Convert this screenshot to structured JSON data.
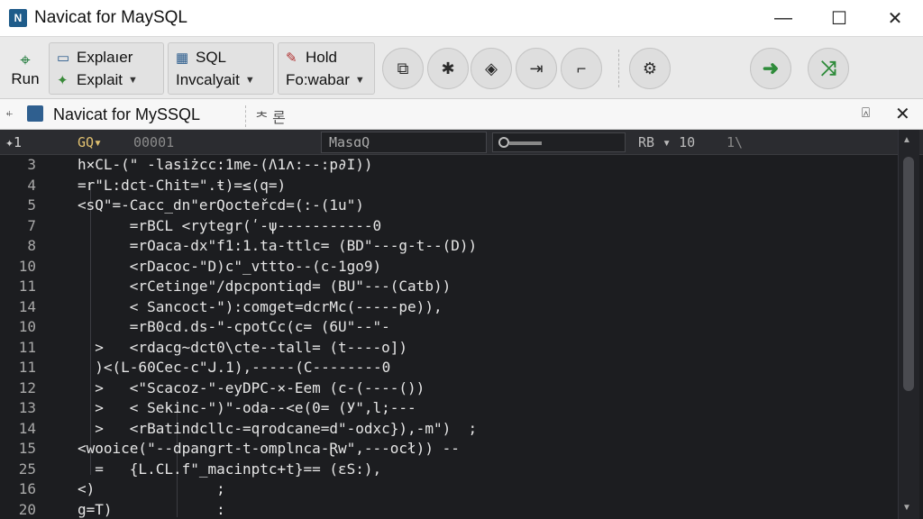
{
  "window": {
    "title": "Navicat for MaySQL",
    "icon_name": "navicat-app-icon",
    "minimize": "—",
    "maximize": "☐",
    "close": "✕"
  },
  "toolbar": {
    "run_label": "Run",
    "groups": [
      {
        "top": "Explaıer",
        "bottom": "Explait"
      },
      {
        "top": "SQL",
        "bottom": "Invcalyait"
      },
      {
        "top": "Hold",
        "bottom": "Fo:wabar"
      }
    ],
    "icon_buttons": [
      "format-icon",
      "bug-icon",
      "layers-icon",
      "step-icon",
      "indent-icon",
      "settings-icon",
      "forward-icon",
      "shuffle-icon"
    ]
  },
  "document_tab": {
    "title": "Navicat for MySSQL",
    "extra": "ᄎ 론"
  },
  "editor_toolbar": {
    "line": "✦1",
    "db": "GQ▾",
    "connection": "00001",
    "query": "MasɑQ",
    "encoding": "RB ▾ 10",
    "page": "1\\"
  },
  "line_numbers": [
    "3",
    "4",
    "5",
    "7",
    "8",
    "10",
    "11",
    "14",
    "10",
    "11",
    "11",
    "12",
    "13",
    "14",
    "15",
    "25",
    "16",
    "20"
  ],
  "code_lines": [
    "h×CL-(\" -lasiżcc:1me-(Ʌ1ʌ:--:p∂I))",
    "=r\"L:dct-Chit=\".ŧ)=≤(q=)",
    "<sQ\"=-Cacc_dn\"erQocteřcd=(:-(1u\")",
    "      =rBCL <rytegr(ʹ-ψ-----------0",
    "      =rOaca-dx\"f1:1.ta-ttlc= (BD\"---g-t--(D))",
    "      <rDacoc-\"D)c\"_vttto--(c-1go9)",
    "      <rCetinge\"/dpcpontiqd= (BU\"---(Catb))",
    "      < Sancoct-\"):comget=dcrMc(-----pe)),",
    "      =rB0cd.ds-\"-cpotCc(c= (6U\"--\"-",
    "  >   <rdacg~dct0\\cte--tall= (t----o])",
    "  )<(L-60Cec-c\"ᒍ.1),-----(C--------0",
    "  >   <\"Scacoz-\"-eyDPC-⨯-Eem (c-(----())",
    "  >   < Sekinc-\")\"-oda--<e(0= (У\",l;---",
    "  >   <rBatindcllc-=qrodcane=d\"-odxc}),-m\")  ;",
    "<wooice(\"--dpangrt-t-omplnca-Ɽw\",---ocł)) --",
    "  =   {L.CL.f\"_macinptc+t}== (ԑS:),",
    "<)              ;",
    "g=T)            :"
  ],
  "colors": {
    "editor_bg": "#1c1d20",
    "code_text": "#e6e6e6",
    "line_number": "#a9a9a9",
    "accent_green": "#2e8b3a"
  }
}
